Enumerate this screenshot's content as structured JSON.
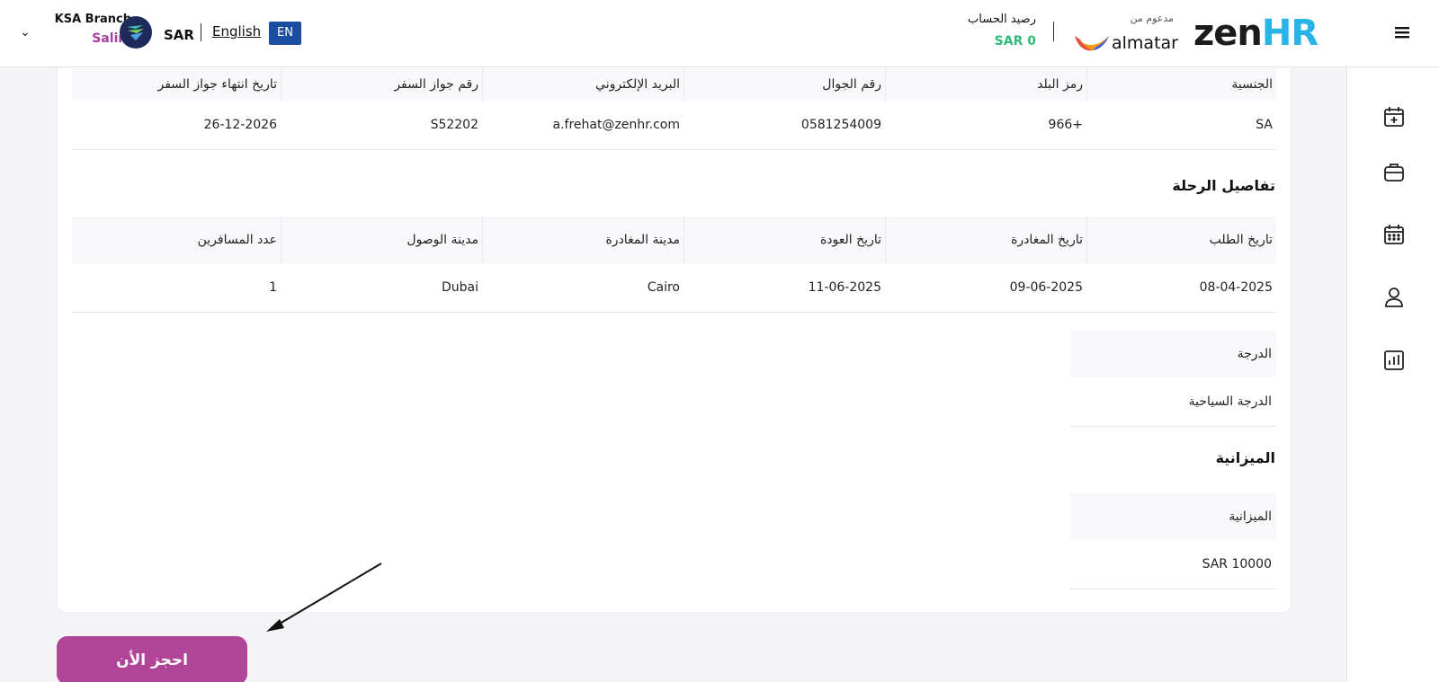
{
  "header": {
    "branch_name": "KSA Branch",
    "user_name": "Salim",
    "currency": "SAR",
    "language_link": "English",
    "language_badge": "EN",
    "balance_label": "رصيد الحساب",
    "balance_value": "SAR 0",
    "powered_by": "مدعوم من",
    "almatar_name": "almatar",
    "zen_logo_main": "zen",
    "zen_logo_accent": "HR"
  },
  "sidebar": {
    "icons": [
      "calendar-plus-icon",
      "briefcase-icon",
      "calendar-icon",
      "user-icon",
      "report-chart-icon"
    ]
  },
  "traveler": {
    "headers": [
      "الجنسية",
      "رمز البلد",
      "رقم الجوال",
      "البريد الإلكتروني",
      "رقم جواز السفر",
      "تاريخ انتهاء جواز السفر"
    ],
    "values": [
      "SA",
      "966+",
      "0581254009",
      "a.frehat@zenhr.com",
      "S52202",
      "26-12-2026"
    ]
  },
  "trip": {
    "title": "تفاصيل الرحلة",
    "headers": [
      "تاريخ الطلب",
      "تاريخ المغادرة",
      "تاريخ العودة",
      "مدينة المغادرة",
      "مدينة الوصول",
      "عدد المسافرين"
    ],
    "values": [
      "08-04-2025",
      "09-06-2025",
      "11-06-2025",
      "Cairo",
      "Dubai",
      "1"
    ]
  },
  "class_info": {
    "header": "الدرجة",
    "value": "الدرجة السياحية"
  },
  "budget": {
    "title": "الميزانية",
    "header": "الميزانية",
    "value": "SAR 10000"
  },
  "book_button_label": "احجز الأن",
  "colors": {
    "brand_purple": "#b04496",
    "balance_green": "#2fb97a",
    "badge_blue": "#1b4ea0",
    "zen_accent": "#2ab3e6"
  }
}
